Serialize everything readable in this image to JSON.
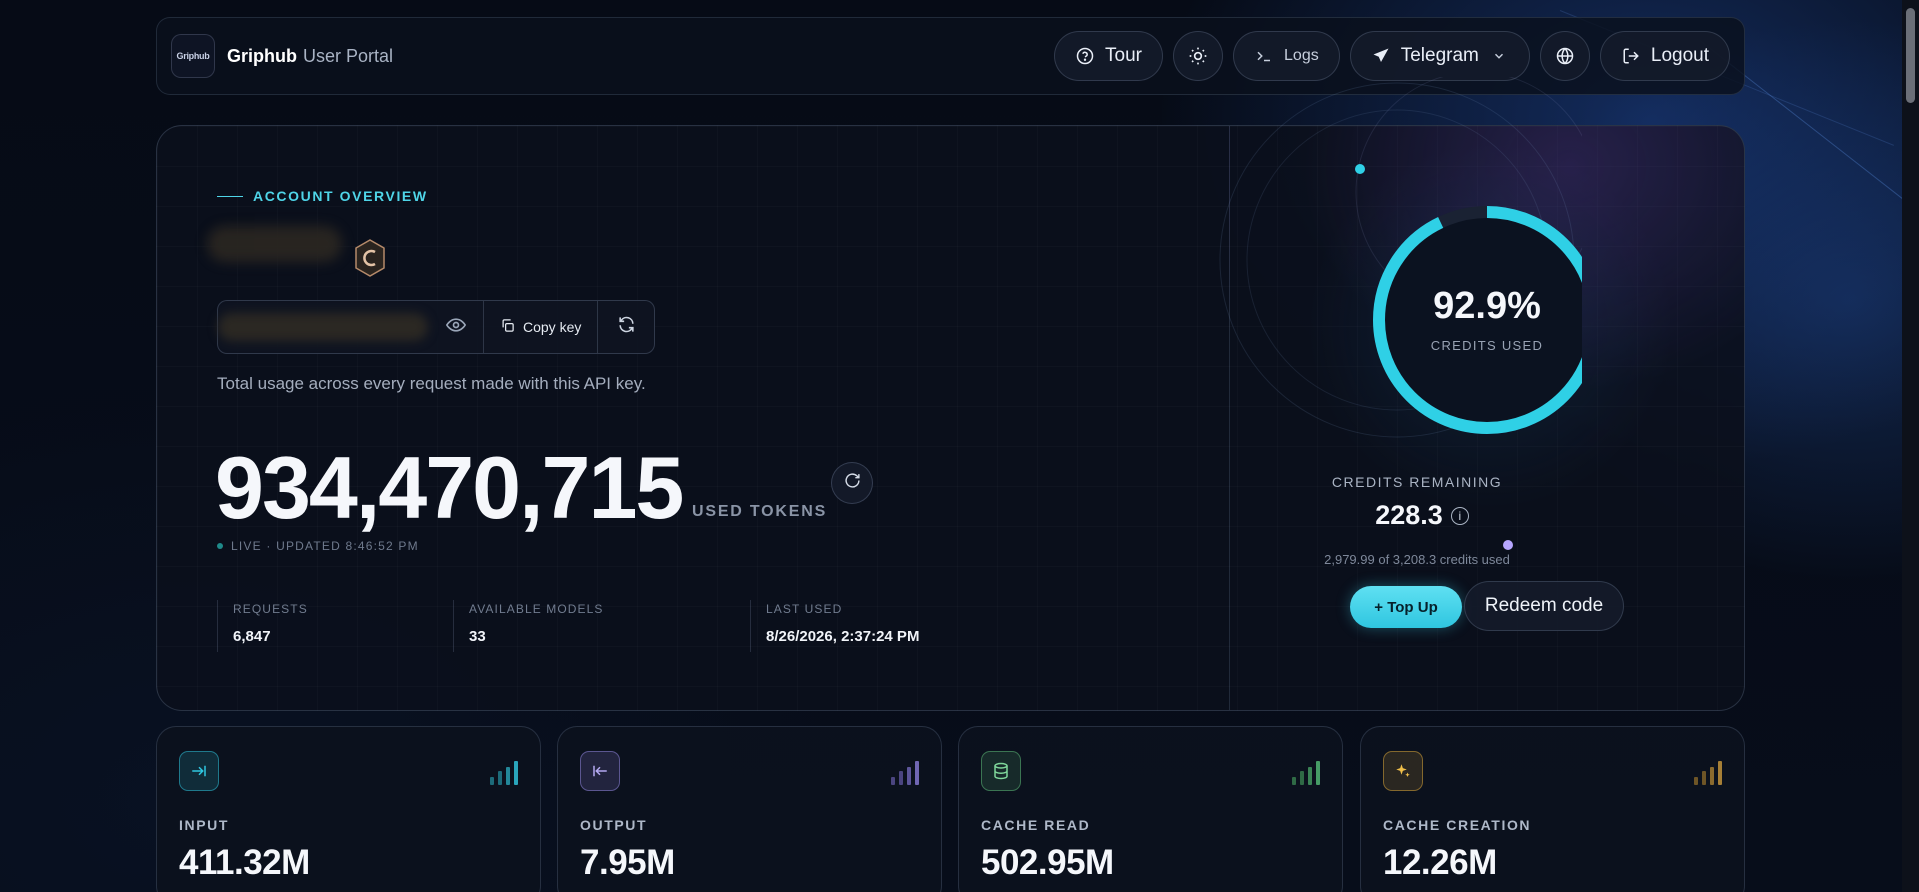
{
  "header": {
    "logo_text": "Griphub",
    "brand": "Griphub",
    "brand_sub": "User Portal",
    "tour_label": "Tour",
    "logs_label": "Logs",
    "telegram_label": "Telegram",
    "logout_label": "Logout"
  },
  "overview": {
    "eyebrow": "ACCOUNT OVERVIEW",
    "copy_key_label": "Copy key",
    "description": "Total usage across every request made with this API key.",
    "used_tokens": "934,470,715",
    "used_tokens_label": "USED TOKENS",
    "live_status": "LIVE · UPDATED 8:46:52 PM",
    "stats": [
      {
        "label": "REQUESTS",
        "value": "6,847"
      },
      {
        "label": "AVAILABLE MODELS",
        "value": "33"
      },
      {
        "label": "LAST USED",
        "value": "8/26/2026, 2:37:24 PM"
      }
    ]
  },
  "credits": {
    "percent_used": "92.9%",
    "percent_used_value": 0.929,
    "credits_used_label": "CREDITS USED",
    "remaining_label": "CREDITS REMAINING",
    "remaining_value": "228.3",
    "info_glyph": "i",
    "usage_summary": "2,979.99 of 3,208.3 credits used",
    "topup_label": "+ Top Up",
    "redeem_label": "Redeem code",
    "accent_color": "#2fd0e6"
  },
  "cards": [
    {
      "label": "INPUT",
      "value": "411.32M",
      "icon": "arrow-right-to-bar-icon",
      "color": "#2fc6e0"
    },
    {
      "label": "OUTPUT",
      "value": "7.95M",
      "icon": "arrow-left-from-bar-icon",
      "color": "#8b7fd6"
    },
    {
      "label": "CACHE READ",
      "value": "502.95M",
      "icon": "database-icon",
      "color": "#5fbf7a"
    },
    {
      "label": "CACHE CREATION",
      "value": "12.26M",
      "icon": "sparkles-icon",
      "color": "#e0a93a"
    }
  ]
}
